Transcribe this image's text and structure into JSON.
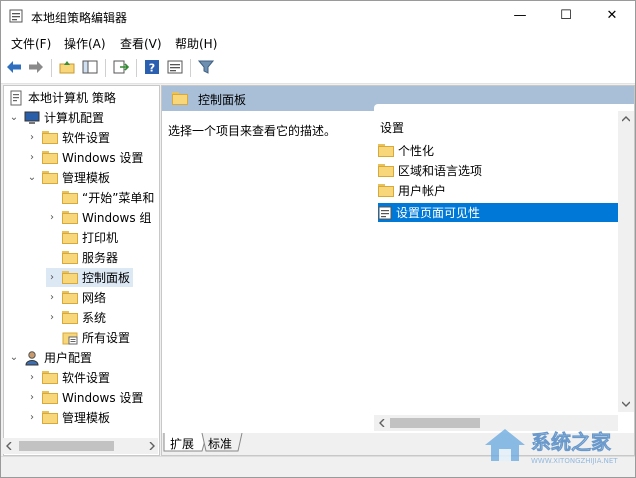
{
  "window": {
    "title": "本地组策略编辑器",
    "minimize_glyph": "—",
    "maximize_glyph": "☐",
    "close_glyph": "✕"
  },
  "menu": {
    "items": [
      "文件(F)",
      "操作(A)",
      "查看(V)",
      "帮助(H)"
    ]
  },
  "tree": {
    "root": "本地计算机 策略",
    "computer_config": "计算机配置",
    "cc_software": "软件设置",
    "cc_windows": "Windows 设置",
    "cc_admin": "管理模板",
    "at_start": "“开始”菜单和",
    "at_windows": "Windows 组",
    "at_printer": "打印机",
    "at_server": "服务器",
    "at_control": "控制面板",
    "at_network": "网络",
    "at_system": "系统",
    "at_all": "所有设置",
    "user_config": "用户配置",
    "uc_software": "软件设置",
    "uc_windows": "Windows 设置",
    "uc_admin": "管理模板"
  },
  "detail": {
    "header": "控制面板",
    "description": "选择一个项目来查看它的描述。",
    "column": "设置",
    "items": [
      "个性化",
      "区域和语言选项",
      "用户帐户",
      "设置页面可见性"
    ],
    "selected_index": 3
  },
  "tabs": [
    "扩展",
    "标准"
  ],
  "watermark": {
    "text": "系统之家",
    "url": "WWW.XITONGZHIJIA.NET"
  },
  "colors": {
    "selection": "#0078d7",
    "header": "#a9bfd8",
    "folder": "#f7d77a"
  }
}
